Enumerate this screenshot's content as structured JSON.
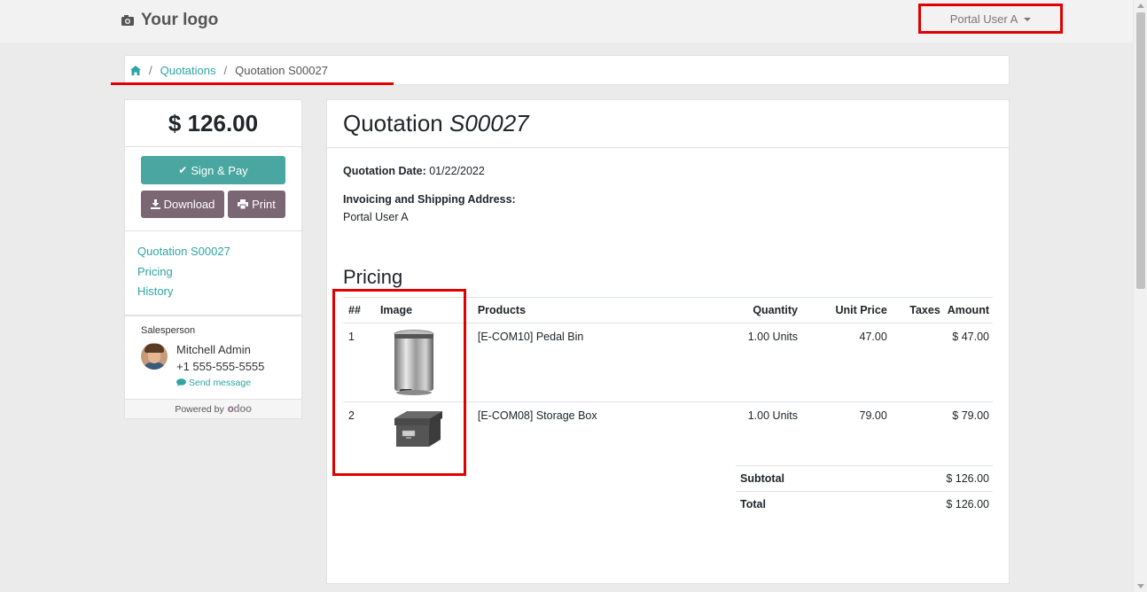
{
  "header": {
    "logo_text": "Your logo",
    "user_menu_label": "Portal User A"
  },
  "breadcrumb": {
    "items": [
      "Quotations"
    ],
    "current": "Quotation S00027"
  },
  "sidebar": {
    "amount": "$ 126.00",
    "sign_pay_label": "Sign & Pay",
    "download_label": "Download",
    "print_label": "Print",
    "nav": [
      "Quotation S00027",
      "Pricing",
      "History"
    ],
    "salesperson_label": "Salesperson",
    "salesperson_name": "Mitchell Admin",
    "salesperson_phone": "+1 555-555-5555",
    "send_message_label": "Send message",
    "powered_by": "Powered by"
  },
  "main": {
    "title_prefix": "Quotation",
    "title_ref": "S00027",
    "quotation_date_label": "Quotation Date:",
    "quotation_date": "01/22/2022",
    "address_label": "Invoicing and Shipping Address:",
    "address_value": "Portal User A",
    "pricing_title": "Pricing",
    "columns": [
      "##",
      "Image",
      "Products",
      "Quantity",
      "Unit Price",
      "Taxes",
      "Amount"
    ],
    "lines": [
      {
        "num": "1",
        "product": "[E-COM10] Pedal Bin",
        "quantity": "1.00 Units",
        "unit_price": "47.00",
        "taxes": "",
        "amount": "$ 47.00",
        "image": "pedal-bin"
      },
      {
        "num": "2",
        "product": "[E-COM08] Storage Box",
        "quantity": "1.00 Units",
        "unit_price": "79.00",
        "taxes": "",
        "amount": "$ 79.00",
        "image": "storage-box"
      }
    ],
    "subtotal_label": "Subtotal",
    "subtotal_value": "$ 126.00",
    "total_label": "Total",
    "total_value": "$ 126.00"
  },
  "colors": {
    "accent": "#2fa4a4",
    "sign_button": "#4aa6a0",
    "secondary_button": "#7b6674",
    "annotation": "#e00000"
  }
}
